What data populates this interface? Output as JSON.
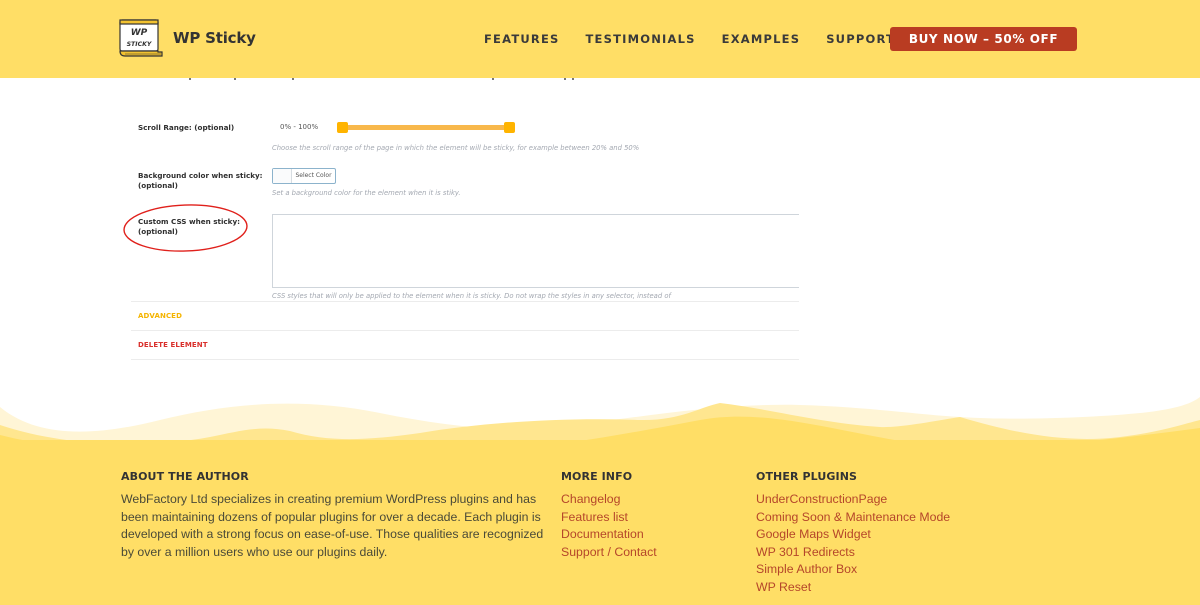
{
  "header": {
    "brand": "WP Sticky",
    "logo_text_top": "WP",
    "logo_text_bottom": "STICKY",
    "nav": [
      {
        "label": "FEATURES"
      },
      {
        "label": "TESTIMONIALS"
      },
      {
        "label": "EXAMPLES"
      },
      {
        "label": "SUPPORT"
      }
    ],
    "cta": "BUY NOW – 50% OFF",
    "colors": {
      "background": "#ffde66",
      "cta": "#b93c22"
    }
  },
  "form": {
    "scroll_range": {
      "label": "Scroll Range: (optional)",
      "value_text": "0% - 100%",
      "min_percent": 0,
      "max_percent": 100,
      "help": "Choose the scroll range of the page in which the element will be sticky, for example between 20% and 50%"
    },
    "background_color": {
      "label_line1": "Background color when sticky:",
      "label_line2": "(optional)",
      "button": "Select Color",
      "help": "Set a background color for the element when it is stiky."
    },
    "custom_css": {
      "label_line1": "Custom CSS when sticky:",
      "label_line2": "(optional)",
      "value": "",
      "help": "CSS styles that will only be applied to the element when it is sticky. Do not wrap the styles in any selector, instead of",
      "highlighted": true
    },
    "sections": {
      "advanced": "ADVANCED",
      "delete": "DELETE ELEMENT"
    },
    "colors": {
      "advanced": "#f5b400",
      "delete": "#d9302c",
      "highlight": "#e0201b"
    }
  },
  "footer": {
    "about": {
      "title": "ABOUT THE AUTHOR",
      "text": "WebFactory Ltd specializes in creating premium WordPress plugins and has been maintaining dozens of popular plugins for over a decade. Each plugin is developed with a strong focus on ease-of-use. Those qualities are recognized by over a million users who use our plugins daily."
    },
    "more_info": {
      "title": "MORE INFO",
      "links": [
        "Changelog",
        "Features list",
        "Documentation",
        "Support / Contact"
      ]
    },
    "other_plugins": {
      "title": "OTHER PLUGINS",
      "links": [
        "UnderConstructionPage",
        "Coming Soon & Maintenance Mode",
        "Google Maps Widget",
        "WP 301 Redirects",
        "Simple Author Box",
        "WP Reset"
      ]
    }
  }
}
